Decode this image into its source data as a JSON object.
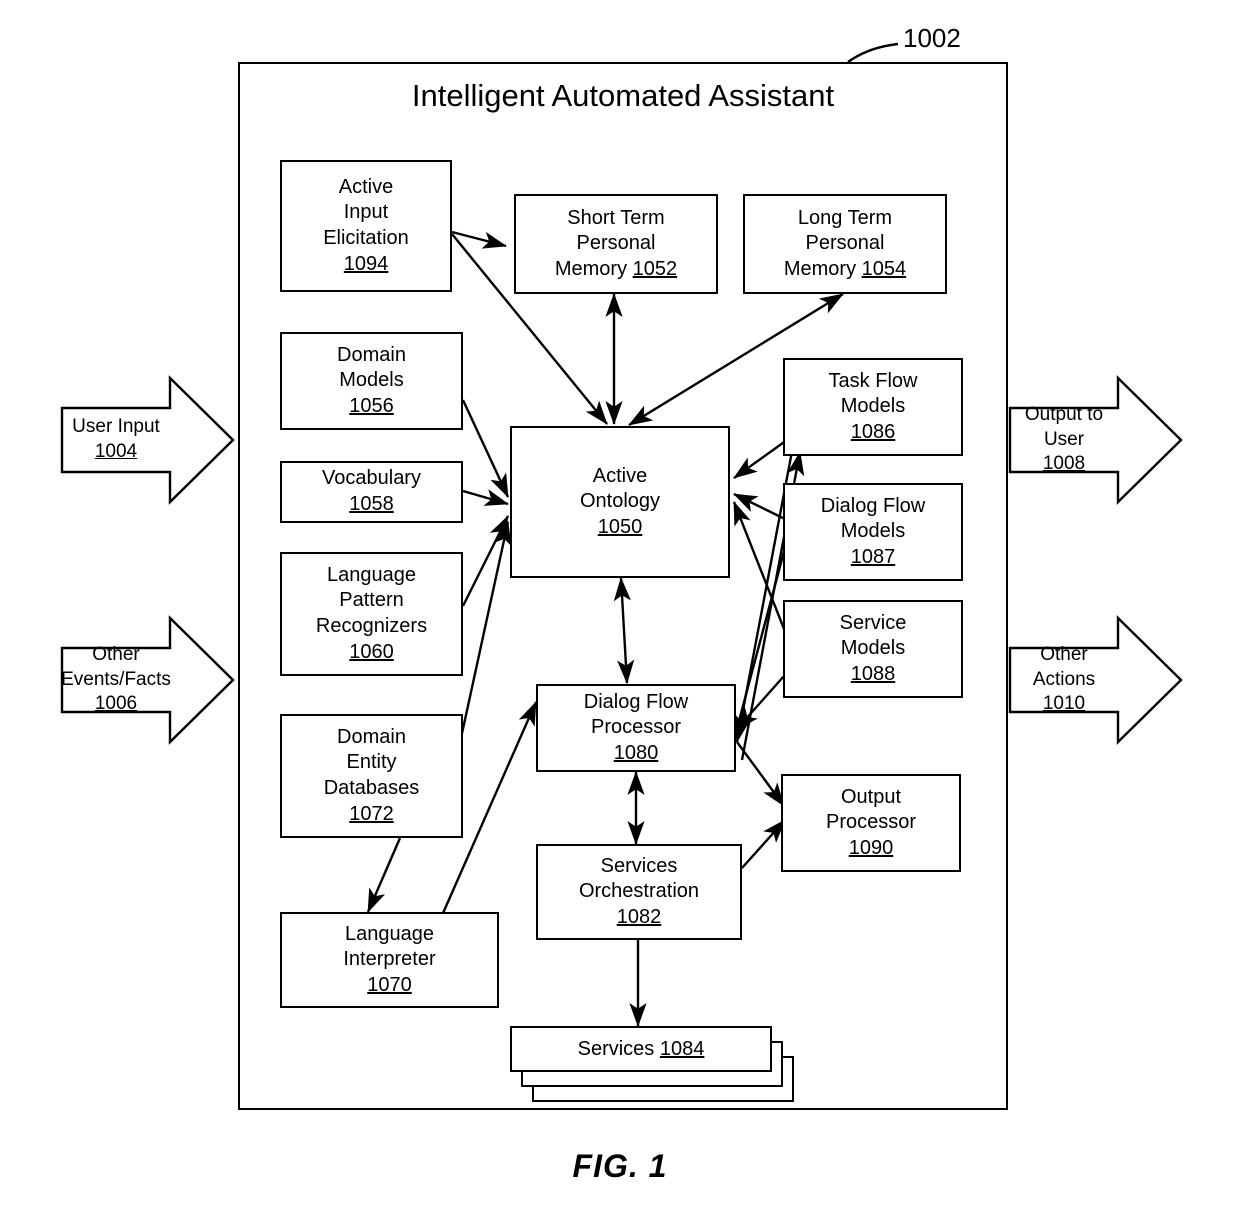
{
  "figure": {
    "caption": "FIG. 1",
    "system_reference": "1002",
    "title": "Intelligent Automated Assistant"
  },
  "style": {
    "line_color": "#000000",
    "fill_color": "#ffffff"
  },
  "io_arrows": [
    {
      "id": "user-input",
      "lines": [
        "User Input"
      ],
      "ref": "1004",
      "side": "left",
      "direction": "right"
    },
    {
      "id": "other-events-facts",
      "lines": [
        "Other",
        "Events/Facts"
      ],
      "ref": "1006",
      "side": "left",
      "direction": "right"
    },
    {
      "id": "output-to-user",
      "lines": [
        "Output to",
        "User"
      ],
      "ref": "1008",
      "side": "right",
      "direction": "right"
    },
    {
      "id": "other-actions",
      "lines": [
        "Other",
        "Actions"
      ],
      "ref": "1010",
      "side": "right",
      "direction": "right"
    }
  ],
  "nodes": [
    {
      "id": "active-input-elicitation",
      "lines": [
        "Active",
        "Input",
        "Elicitation"
      ],
      "ref": "1094",
      "ref_inline": false
    },
    {
      "id": "short-term-personal-memory",
      "lines": [
        "Short Term",
        "Personal",
        "Memory"
      ],
      "ref": "1052",
      "ref_inline": true
    },
    {
      "id": "long-term-personal-memory",
      "lines": [
        "Long Term",
        "Personal",
        "Memory"
      ],
      "ref": "1054",
      "ref_inline": true
    },
    {
      "id": "domain-models",
      "lines": [
        "Domain",
        "Models"
      ],
      "ref": "1056",
      "ref_inline": false
    },
    {
      "id": "vocabulary",
      "lines": [
        "Vocabulary"
      ],
      "ref": "1058",
      "ref_inline": false
    },
    {
      "id": "language-pattern-recognizers",
      "lines": [
        "Language",
        "Pattern",
        "Recognizers"
      ],
      "ref": "1060",
      "ref_inline": false
    },
    {
      "id": "domain-entity-databases",
      "lines": [
        "Domain",
        "Entity",
        "Databases"
      ],
      "ref": "1072",
      "ref_inline": false
    },
    {
      "id": "language-interpreter",
      "lines": [
        "Language",
        "Interpreter"
      ],
      "ref": "1070",
      "ref_inline": false
    },
    {
      "id": "active-ontology",
      "lines": [
        "Active",
        "Ontology"
      ],
      "ref": "1050",
      "ref_inline": false
    },
    {
      "id": "dialog-flow-processor",
      "lines": [
        "Dialog Flow",
        "Processor"
      ],
      "ref": "1080",
      "ref_inline": false
    },
    {
      "id": "services-orchestration",
      "lines": [
        "Services",
        "Orchestration"
      ],
      "ref": "1082",
      "ref_inline": false
    },
    {
      "id": "task-flow-models",
      "lines": [
        "Task Flow",
        "Models"
      ],
      "ref": "1086",
      "ref_inline": false
    },
    {
      "id": "dialog-flow-models",
      "lines": [
        "Dialog Flow",
        "Models"
      ],
      "ref": "1087",
      "ref_inline": false
    },
    {
      "id": "service-models",
      "lines": [
        "Service",
        "Models"
      ],
      "ref": "1088",
      "ref_inline": false
    },
    {
      "id": "output-processor",
      "lines": [
        "Output",
        "Processor"
      ],
      "ref": "1090",
      "ref_inline": false
    },
    {
      "id": "services",
      "lines": [
        "Services"
      ],
      "ref": "1084",
      "ref_inline": true
    }
  ],
  "node_text": {
    "active_input_elicitation": {
      "l1": "Active",
      "l2": "Input",
      "l3": "Elicitation",
      "ref": "1094"
    },
    "short_term_personal_memory": {
      "l1": "Short Term",
      "l2": "Personal",
      "l3": "Memory",
      "ref": "1052"
    },
    "long_term_personal_memory": {
      "l1": "Long Term",
      "l2": "Personal",
      "l3": "Memory",
      "ref": "1054"
    },
    "domain_models": {
      "l1": "Domain",
      "l2": "Models",
      "ref": "1056"
    },
    "vocabulary": {
      "l1": "Vocabulary",
      "ref": "1058"
    },
    "language_pattern_recognizers": {
      "l1": "Language",
      "l2": "Pattern",
      "l3": "Recognizers",
      "ref": "1060"
    },
    "domain_entity_databases": {
      "l1": "Domain",
      "l2": "Entity",
      "l3": "Databases",
      "ref": "1072"
    },
    "language_interpreter": {
      "l1": "Language",
      "l2": "Interpreter",
      "ref": "1070"
    },
    "active_ontology": {
      "l1": "Active",
      "l2": "Ontology",
      "ref": "1050"
    },
    "dialog_flow_processor": {
      "l1": "Dialog Flow",
      "l2": "Processor",
      "ref": "1080"
    },
    "services_orchestration": {
      "l1": "Services",
      "l2": "Orchestration",
      "ref": "1082"
    },
    "task_flow_models": {
      "l1": "Task Flow",
      "l2": "Models",
      "ref": "1086"
    },
    "dialog_flow_models": {
      "l1": "Dialog Flow",
      "l2": "Models",
      "ref": "1087"
    },
    "service_models": {
      "l1": "Service",
      "l2": "Models",
      "ref": "1088"
    },
    "output_processor": {
      "l1": "Output",
      "l2": "Processor",
      "ref": "1090"
    },
    "services": {
      "l1": "Services",
      "ref": "1084"
    },
    "user_input": {
      "l1": "User Input",
      "ref": "1004"
    },
    "other_events_facts": {
      "l1": "Other",
      "l2": "Events/Facts",
      "ref": "1006"
    },
    "output_to_user": {
      "l1": "Output to",
      "l2": "User",
      "ref": "1008"
    },
    "other_actions": {
      "l1": "Other",
      "l2": "Actions",
      "ref": "1010"
    }
  },
  "connections": [
    {
      "from": "active-input-elicitation",
      "to": "short-term-personal-memory",
      "arrow": "single"
    },
    {
      "from": "active-input-elicitation",
      "to": "active-ontology",
      "arrow": "single"
    },
    {
      "from": "short-term-personal-memory",
      "to": "active-ontology",
      "arrow": "double"
    },
    {
      "from": "long-term-personal-memory",
      "to": "active-ontology",
      "arrow": "double"
    },
    {
      "from": "domain-models",
      "to": "active-ontology",
      "arrow": "single"
    },
    {
      "from": "vocabulary",
      "to": "active-ontology",
      "arrow": "single"
    },
    {
      "from": "language-pattern-recognizers",
      "to": "active-ontology",
      "arrow": "single"
    },
    {
      "from": "domain-entity-databases",
      "to": "active-ontology",
      "arrow": "single"
    },
    {
      "from": "domain-entity-databases",
      "to": "language-interpreter",
      "arrow": "single"
    },
    {
      "from": "language-interpreter",
      "to": "active-ontology",
      "arrow": "single"
    },
    {
      "from": "active-ontology",
      "to": "dialog-flow-processor",
      "arrow": "double"
    },
    {
      "from": "task-flow-models",
      "to": "active-ontology",
      "arrow": "single"
    },
    {
      "from": "dialog-flow-models",
      "to": "active-ontology",
      "arrow": "single"
    },
    {
      "from": "service-models",
      "to": "active-ontology",
      "arrow": "single"
    },
    {
      "from": "task-flow-models",
      "to": "dialog-flow-processor",
      "arrow": "single"
    },
    {
      "from": "dialog-flow-models",
      "to": "dialog-flow-processor",
      "arrow": "single"
    },
    {
      "from": "service-models",
      "to": "dialog-flow-processor",
      "arrow": "single"
    },
    {
      "from": "dialog-flow-processor",
      "to": "services-orchestration",
      "arrow": "double"
    },
    {
      "from": "services-orchestration",
      "to": "services",
      "arrow": "double"
    },
    {
      "from": "services-orchestration",
      "to": "output-processor",
      "arrow": "single"
    },
    {
      "from": "dialog-flow-processor",
      "to": "output-processor",
      "arrow": "single"
    }
  ]
}
